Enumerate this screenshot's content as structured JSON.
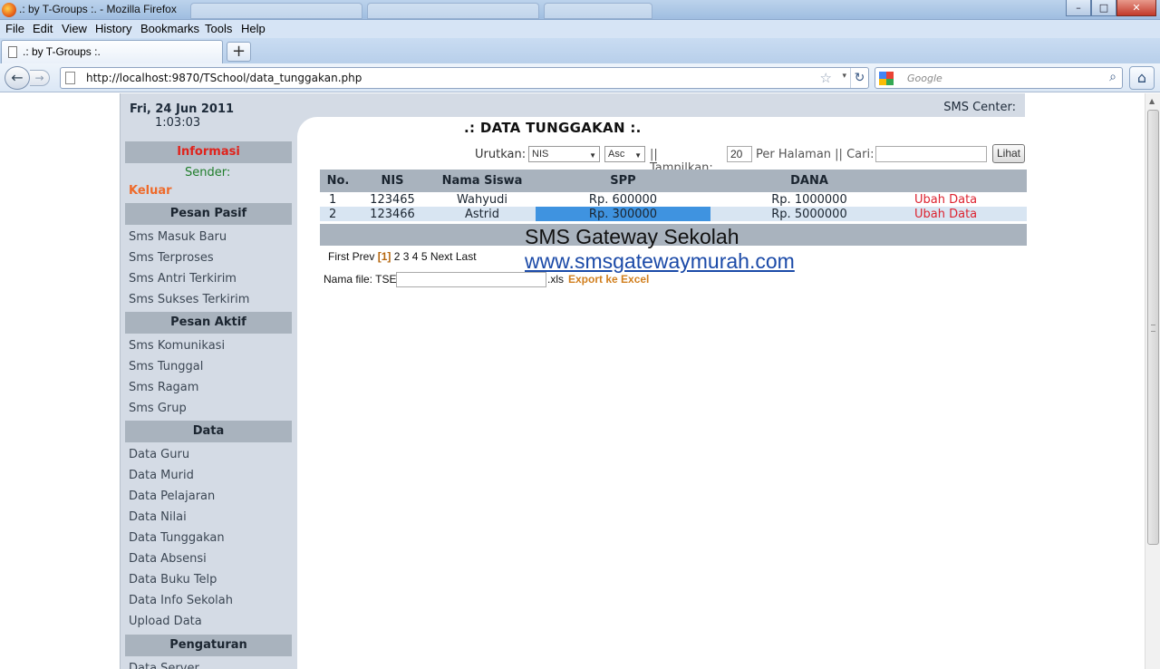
{
  "window": {
    "title": ".: by T-Groups :. - Mozilla Firefox",
    "min_glyph": "–",
    "max_glyph": "□",
    "close_glyph": "✕"
  },
  "menu": {
    "file": "File",
    "edit": "Edit",
    "view": "View",
    "history": "History",
    "bookmarks": "Bookmarks",
    "tools": "Tools",
    "help": "Help"
  },
  "tab": {
    "title": ".: by T-Groups :.",
    "new_tab_glyph": "+"
  },
  "nav": {
    "back_glyph": "←",
    "forward_glyph": "→",
    "url": "http://localhost:9870/TSchool/data_tunggakan.php",
    "star_glyph": "☆",
    "dropdown_glyph": "▾",
    "reload_glyph": "↻",
    "search_placeholder": "Google",
    "search_glyph": "⌕",
    "home_glyph": "⌂"
  },
  "header": {
    "date": "Fri, 24 Jun 2011",
    "time": "1:03:03",
    "sms_center": "SMS Center:"
  },
  "sidebar": {
    "informasi": "Informasi",
    "sender": "Sender:",
    "keluar": "Keluar",
    "sections": [
      {
        "title": "Pesan Pasif",
        "items": [
          "Sms Masuk Baru",
          "Sms Terproses",
          "Sms Antri Terkirim",
          "Sms Sukses Terkirim"
        ]
      },
      {
        "title": "Pesan Aktif",
        "items": [
          "Sms Komunikasi",
          "Sms Tunggal",
          "Sms Ragam",
          "Sms Grup"
        ]
      },
      {
        "title": "Data",
        "items": [
          "Data Guru",
          "Data Murid",
          "Data Pelajaran",
          "Data Nilai",
          "Data Tunggakan",
          "Data Absensi",
          "Data Buku Telp",
          "Data Info Sekolah",
          "Upload Data"
        ]
      },
      {
        "title": "Pengaturan",
        "items": [
          "Data Server"
        ]
      }
    ]
  },
  "main": {
    "title": ".: DATA TUNGGAKAN :.",
    "filter": {
      "urutkan_label": "Urutkan:",
      "sort_field": "NIS",
      "sort_order": "Asc",
      "tampilkan_label": "|| Tampilkan:",
      "per_page": "20",
      "per_halaman_label": "Per Halaman || Cari:",
      "cari_value": "",
      "lihat_button": "Lihat"
    },
    "table": {
      "headers": [
        "No.",
        "NIS",
        "Nama Siswa",
        "SPP",
        "DANA",
        ""
      ],
      "rows": [
        {
          "no": "1",
          "nis": "123465",
          "nama": "Wahyudi",
          "spp": "Rp. 600000",
          "dana": "Rp. 1000000",
          "action": "Ubah Data"
        },
        {
          "no": "2",
          "nis": "123466",
          "nama": "Astrid",
          "spp": "Rp. 300000",
          "dana": "Rp. 5000000",
          "action": "Ubah Data"
        }
      ]
    },
    "pager": {
      "first": "First",
      "prev": "Prev",
      "current": "[1]",
      "pages": [
        "2",
        "3",
        "4",
        "5"
      ],
      "next": "Next",
      "last": "Last"
    },
    "export": {
      "label": "Nama file: TSE",
      "filename_value": "",
      "ext": ".xls",
      "link": "Export ke Excel"
    },
    "watermark": {
      "line1": "SMS Gateway Sekolah",
      "line2": "www.smsgatewaymurah.com"
    }
  },
  "colors": {
    "section_header": "#a9b3be",
    "sidebar_bg": "#d4dbe5",
    "informasi": "#e0231c",
    "keluar": "#ee6a2a",
    "edit_link": "#dd2330",
    "selected_cell": "#3f93e0",
    "export_link": "#d17f1e",
    "watermark_link": "#1b4aa8"
  }
}
